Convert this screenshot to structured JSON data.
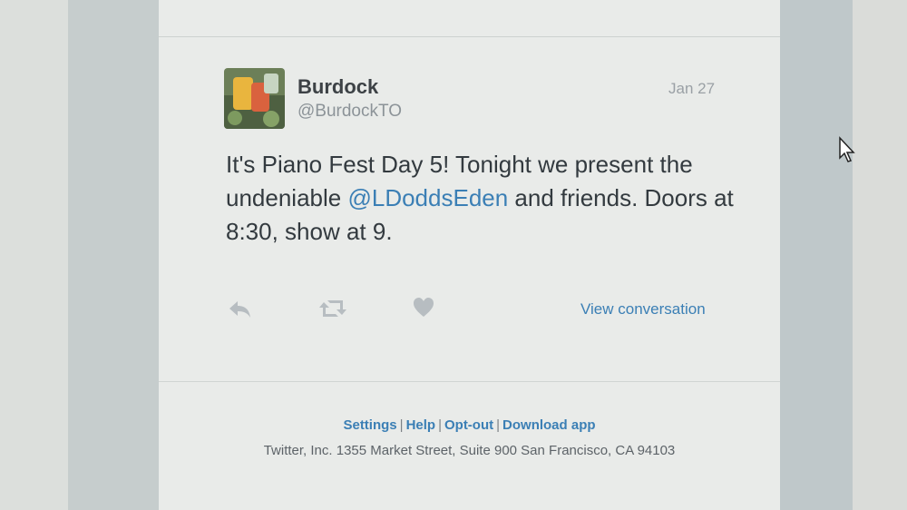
{
  "tweet": {
    "author_name": "Burdock",
    "author_handle": "@BurdockTO",
    "date": "Jan 27",
    "text_part1": "It's Piano Fest Day 5! Tonight we present the undeniable ",
    "mention": "@LDoddsEden",
    "text_part2": " and friends. Doors at 8:30, show at 9."
  },
  "actions": {
    "reply_icon": "reply-icon",
    "retweet_icon": "retweet-icon",
    "like_icon": "heart-icon",
    "view_conversation_label": "View conversation"
  },
  "footer": {
    "links": [
      "Settings",
      "Help",
      "Opt-out",
      "Download app"
    ],
    "separator": "|",
    "address": "Twitter, Inc. 1355 Market Street, Suite 900 San Francisco, CA 94103"
  },
  "colors": {
    "link": "#3b7fb5",
    "text": "#333a3f",
    "muted": "#8c9398",
    "card_bg": "#e9ebe9",
    "sidebar": "#c6cdcd"
  }
}
